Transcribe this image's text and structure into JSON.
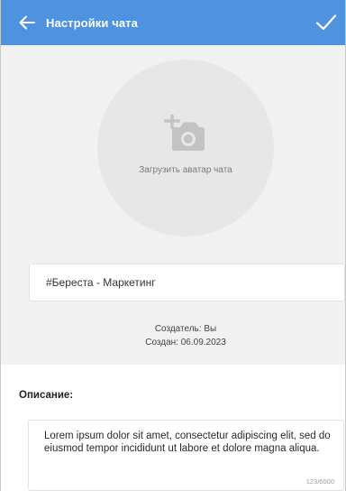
{
  "header": {
    "title": "Настройки чата",
    "back_icon": "arrow-left-icon",
    "confirm_icon": "checkmark-icon",
    "background": "#4f93e0"
  },
  "avatar": {
    "icon": "add-photo-camera-icon",
    "label": "Загрузить аватар чата"
  },
  "chat_name": {
    "value": "#Береста - Маркетинг"
  },
  "meta": {
    "creator": "Создатель: Вы",
    "created": "Создан: 06.09.2023"
  },
  "description": {
    "heading": "Описание:",
    "value": "Lorem ipsum dolor sit amet, consectetur adipiscing elit, sed do eiusmod tempor incididunt ut labore et dolore magna aliqua.",
    "counter": "123/6000"
  }
}
